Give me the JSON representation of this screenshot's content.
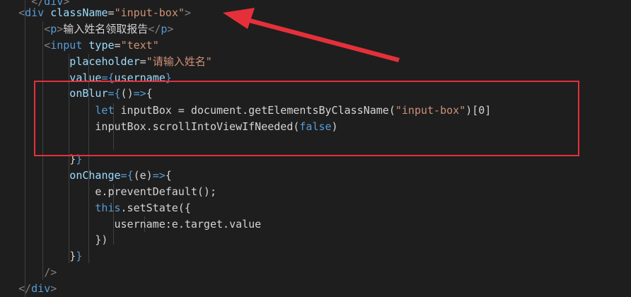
{
  "editor": {
    "background": "#1e1e1e",
    "annotation_color": "#e5303a",
    "lines": [
      {
        "indent": "    ",
        "tokens": [
          {
            "t": "</",
            "c": "punc"
          },
          {
            "t": "div",
            "c": "tag"
          },
          {
            "t": ">",
            "c": "punc"
          }
        ]
      },
      {
        "indent": "  ",
        "tokens": [
          {
            "t": "<",
            "c": "punc"
          },
          {
            "t": "div",
            "c": "tag"
          },
          {
            "t": " ",
            "c": "txt"
          },
          {
            "t": "className",
            "c": "attr"
          },
          {
            "t": "=",
            "c": "txt"
          },
          {
            "t": "\"input-box\"",
            "c": "str"
          },
          {
            "t": ">",
            "c": "punc"
          }
        ]
      },
      {
        "indent": "      ",
        "tokens": [
          {
            "t": "<",
            "c": "punc"
          },
          {
            "t": "p",
            "c": "tag"
          },
          {
            "t": ">",
            "c": "punc"
          },
          {
            "t": "输入姓名领取报告",
            "c": "txt cjk"
          },
          {
            "t": "</",
            "c": "punc"
          },
          {
            "t": "p",
            "c": "tag"
          },
          {
            "t": ">",
            "c": "punc"
          }
        ]
      },
      {
        "indent": "      ",
        "tokens": [
          {
            "t": "<",
            "c": "punc"
          },
          {
            "t": "input",
            "c": "tag"
          },
          {
            "t": " ",
            "c": "txt"
          },
          {
            "t": "type",
            "c": "attr"
          },
          {
            "t": "=",
            "c": "txt"
          },
          {
            "t": "\"text\"",
            "c": "str"
          }
        ]
      },
      {
        "indent": "          ",
        "tokens": [
          {
            "t": "placeholder",
            "c": "attr"
          },
          {
            "t": "=",
            "c": "txt"
          },
          {
            "t": "\"",
            "c": "str"
          },
          {
            "t": "请输入姓名",
            "c": "str cjk"
          },
          {
            "t": "\"",
            "c": "str"
          }
        ]
      },
      {
        "indent": "          ",
        "tokens": [
          {
            "t": "value",
            "c": "attr"
          },
          {
            "t": "={",
            "c": "brace"
          },
          {
            "t": "username",
            "c": "attr"
          },
          {
            "t": "}",
            "c": "brace"
          }
        ]
      },
      {
        "indent": "          ",
        "tokens": [
          {
            "t": "onBlur",
            "c": "attr"
          },
          {
            "t": "={",
            "c": "brace"
          },
          {
            "t": "()",
            "c": "txt"
          },
          {
            "t": "=>",
            "c": "kw"
          },
          {
            "t": "{",
            "c": "txt"
          }
        ]
      },
      {
        "indent": "              ",
        "tokens": [
          {
            "t": "let",
            "c": "kw"
          },
          {
            "t": " ",
            "c": "txt"
          },
          {
            "t": "inputBox",
            "c": "txt"
          },
          {
            "t": " = ",
            "c": "txt"
          },
          {
            "t": "document",
            "c": "txt"
          },
          {
            "t": ".",
            "c": "txt"
          },
          {
            "t": "getElementsByClassName",
            "c": "txt"
          },
          {
            "t": "(",
            "c": "txt"
          },
          {
            "t": "\"input-box\"",
            "c": "str"
          },
          {
            "t": ")[",
            "c": "txt"
          },
          {
            "t": "0",
            "c": "txt"
          },
          {
            "t": "]",
            "c": "txt"
          }
        ]
      },
      {
        "indent": "              ",
        "tokens": [
          {
            "t": "inputBox",
            "c": "txt"
          },
          {
            "t": ".",
            "c": "txt"
          },
          {
            "t": "scrollIntoViewIfNeeded",
            "c": "txt"
          },
          {
            "t": "(",
            "c": "txt"
          },
          {
            "t": "false",
            "c": "kw"
          },
          {
            "t": ")",
            "c": "txt"
          }
        ]
      },
      {
        "indent": "",
        "tokens": []
      },
      {
        "indent": "          ",
        "tokens": [
          {
            "t": "}",
            "c": "txt"
          },
          {
            "t": "}",
            "c": "brace"
          }
        ]
      },
      {
        "indent": "          ",
        "tokens": [
          {
            "t": "onChange",
            "c": "attr"
          },
          {
            "t": "={",
            "c": "brace"
          },
          {
            "t": "(e)",
            "c": "txt"
          },
          {
            "t": "=>",
            "c": "kw"
          },
          {
            "t": "{",
            "c": "txt"
          }
        ]
      },
      {
        "indent": "              ",
        "tokens": [
          {
            "t": "e",
            "c": "txt"
          },
          {
            "t": ".",
            "c": "txt"
          },
          {
            "t": "preventDefault",
            "c": "txt"
          },
          {
            "t": "();",
            "c": "txt"
          }
        ]
      },
      {
        "indent": "              ",
        "tokens": [
          {
            "t": "this",
            "c": "kw"
          },
          {
            "t": ".",
            "c": "txt"
          },
          {
            "t": "setState",
            "c": "txt"
          },
          {
            "t": "({",
            "c": "txt"
          }
        ]
      },
      {
        "indent": "                 ",
        "tokens": [
          {
            "t": "username",
            "c": "txt"
          },
          {
            "t": ":",
            "c": "txt"
          },
          {
            "t": "e",
            "c": "txt"
          },
          {
            "t": ".",
            "c": "txt"
          },
          {
            "t": "target",
            "c": "txt"
          },
          {
            "t": ".",
            "c": "txt"
          },
          {
            "t": "value",
            "c": "txt"
          }
        ]
      },
      {
        "indent": "              ",
        "tokens": [
          {
            "t": "})",
            "c": "txt"
          }
        ]
      },
      {
        "indent": "          ",
        "tokens": [
          {
            "t": "}",
            "c": "txt"
          },
          {
            "t": "}",
            "c": "brace"
          }
        ]
      },
      {
        "indent": "      ",
        "tokens": [
          {
            "t": "/>",
            "c": "punc"
          }
        ]
      },
      {
        "indent": "  ",
        "tokens": [
          {
            "t": "</",
            "c": "punc"
          },
          {
            "t": "div",
            "c": "tag"
          },
          {
            "t": ">",
            "c": "punc"
          }
        ]
      }
    ]
  }
}
